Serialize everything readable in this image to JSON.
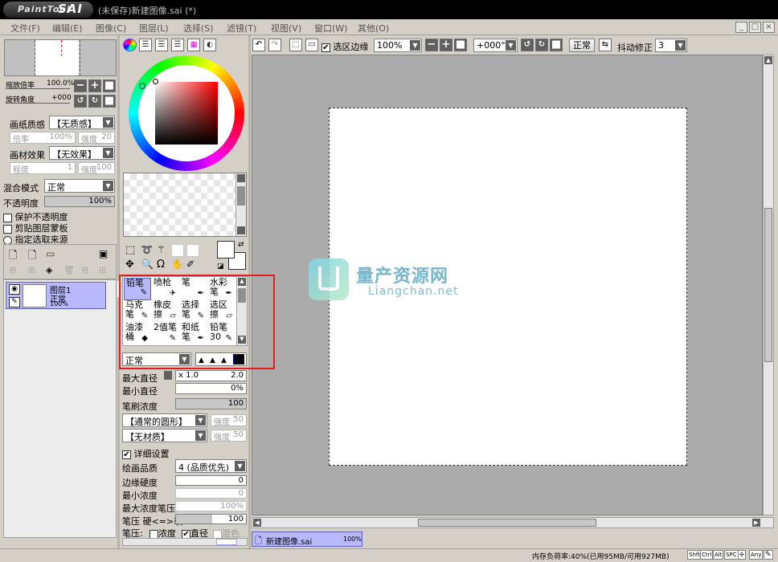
{
  "app": {
    "logo_text": "PaintTool",
    "logo_sai": "SAI",
    "title": "(未保存)新建图像.sai (*)"
  },
  "menu": [
    "文件(F)",
    "编辑(E)",
    "图像(C)",
    "图层(L)",
    "选择(S)",
    "滤镜(T)",
    "视图(V)",
    "窗口(W)",
    "其他(O)"
  ],
  "window_controls": {
    "min": "_",
    "restore": "□",
    "close": "×"
  },
  "navigator": {
    "zoom_label": "缩放倍率",
    "zoom_value": "100.0%",
    "rotate_label": "旋转角度",
    "rotate_value": "+000"
  },
  "paper": {
    "texture_label": "画纸质感",
    "texture_value": "【无质感】",
    "scale_label": "倍率",
    "scale_value": "100%",
    "strength_label": "强度",
    "strength_value": "20",
    "effect_label": "画材效果",
    "effect_value": "【无效果】",
    "degree_label": "程度",
    "degree_value": "1",
    "effect_strength_label": "强度",
    "effect_strength_value": "100"
  },
  "layer_props": {
    "blend_label": "混合模式",
    "blend_value": "正常",
    "opacity_label": "不透明度",
    "opacity_value": "100%",
    "protect_opacity": "保护不透明度",
    "clip_group": "剪贴图层蒙板",
    "selection_source": "指定选取来源"
  },
  "layers": [
    {
      "name": "图层1",
      "mode": "正常",
      "opacity": "100%"
    }
  ],
  "tools": [
    {
      "label": "铅笔",
      "icon": "✎"
    },
    {
      "label": "喷枪",
      "icon": "✈"
    },
    {
      "label": "笔",
      "icon": "✒"
    },
    {
      "label": "水彩笔",
      "icon": "✒"
    },
    {
      "label": "马克笔",
      "icon": "✎"
    },
    {
      "label": "橡皮擦",
      "icon": "▱"
    },
    {
      "label": "选择笔",
      "icon": "✎"
    },
    {
      "label": "选区擦",
      "icon": "▱"
    },
    {
      "label": "油漆桶",
      "icon": "◆"
    },
    {
      "label": "2值笔",
      "icon": "✎"
    },
    {
      "label": "和纸笔",
      "icon": "✒"
    },
    {
      "label": "铅笔30",
      "icon": "✎"
    }
  ],
  "brush": {
    "mode_value": "正常",
    "max_diameter_label": "最大直径",
    "max_diameter_mult": "x 1.0",
    "max_diameter_value": "2.0",
    "min_diameter_label": "最小直径",
    "min_diameter_value": "0%",
    "density_label": "笔刷浓度",
    "density_value": "100",
    "shape_value": "【通常的圆形】",
    "shape_strength_label": "强度",
    "shape_strength_value": "50",
    "texture_value": "【无材质】",
    "texture_strength_label": "强度",
    "texture_strength_value": "50",
    "detail_label": "详细设置",
    "quality_label": "绘画品质",
    "quality_value": "4 (品质优先)",
    "edge_label": "边缘硬度",
    "edge_value": "0",
    "min_density_label": "最小浓度",
    "min_density_value": "0",
    "max_density_pressure_label": "最大浓度笔压",
    "max_density_pressure_value": "100%",
    "pressure_label": "笔压 硬<=>软",
    "pressure_value": "100",
    "pressure_opts_label": "笔压:",
    "opt_density": "浓度",
    "opt_diameter": "直径",
    "opt_blend": "混色"
  },
  "toolbar": {
    "selection_edge_label": "选区边缘",
    "zoom_value": "100%",
    "angle_value": "+000°",
    "mode_label": "正常",
    "stabilizer_label": "抖动修正",
    "stabilizer_value": "3"
  },
  "watermark": {
    "title": "量产资源网",
    "url": "Liangchan.net"
  },
  "document_tab": {
    "name": "新建图像.sai",
    "zoom": "100%"
  },
  "status": {
    "memory": "内存负荷率:40%(已用95MB/可用927MB)",
    "keys": [
      "Shft",
      "Ctrl",
      "Alt",
      "SPC",
      "✣",
      "Any"
    ]
  },
  "colors": {
    "accent_red": "#e02020",
    "selection_blue": "#b8b8ff",
    "canvas_bg": "#ababab"
  }
}
